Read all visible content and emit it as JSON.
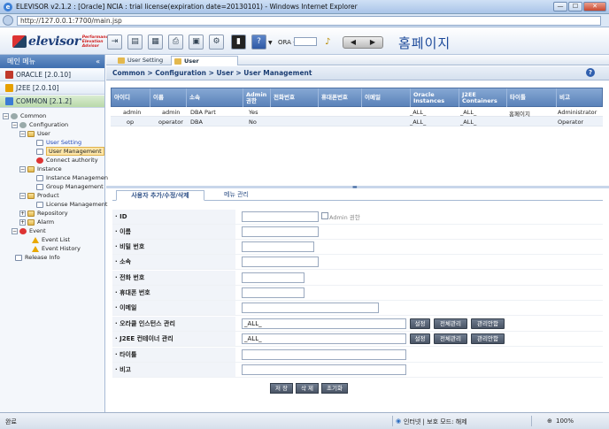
{
  "window": {
    "title": "ELEVISOR v2.1.2 : [Oracle] NCIA : trial license(expiration date=20130101) - Windows Internet Explorer",
    "min": "—",
    "max": "☐",
    "close": "✕",
    "url": "http://127.0.0.1:7700/main.jsp"
  },
  "header": {
    "logo_text": "elevisor",
    "logo_tagline": [
      "Performance",
      "Elevation",
      "Advisor"
    ],
    "ora_label": "ORA -",
    "prev": "◀",
    "next": "▶",
    "home": "홈페이지"
  },
  "sidebar": {
    "title": "메인 메뉴",
    "collapse": "«",
    "groups": [
      {
        "label": "ORACLE [2.0.10]",
        "color": "#c0392b"
      },
      {
        "label": "J2EE [2.0.10]",
        "color": "#e6a000"
      },
      {
        "label": "COMMON [2.1.2]",
        "color": "#3a7bd5"
      }
    ],
    "tree": [
      {
        "label": "Common"
      },
      {
        "label": "Configuration"
      },
      {
        "label": "User"
      },
      {
        "label": "User Setting"
      },
      {
        "label": "User Management"
      },
      {
        "label": "Connect authority"
      },
      {
        "label": "Instance"
      },
      {
        "label": "Instance Managemen"
      },
      {
        "label": "Group Management"
      },
      {
        "label": "Product"
      },
      {
        "label": "License Management"
      },
      {
        "label": "Repository"
      },
      {
        "label": "Alarm"
      },
      {
        "label": "Event"
      },
      {
        "label": "Event List"
      },
      {
        "label": "Event History"
      },
      {
        "label": "Release Info"
      }
    ]
  },
  "tabs": [
    {
      "label": "User Setting"
    },
    {
      "label": "User Management"
    }
  ],
  "breadcrumb": "Common > Configuration > User > User Management",
  "grid": {
    "columns": [
      "아이디",
      "이름",
      "소속",
      "Admin 권한",
      "전화번호",
      "휴대폰번호",
      "이메일",
      "Oracle Instances",
      "J2EE Containers",
      "타이틀",
      "비고"
    ],
    "rows": [
      [
        "admin",
        "admin",
        "DBA Part",
        "Yes",
        "",
        "",
        "",
        "_ALL_",
        "_ALL_",
        "홈페이지",
        "Administrator"
      ],
      [
        "op",
        "operator",
        "DBA",
        "No",
        "",
        "",
        "",
        "_ALL_",
        "_ALL_",
        "",
        "Operator"
      ]
    ]
  },
  "form": {
    "tabs": [
      "사용자 추가/수정/삭제",
      "메뉴 관리"
    ],
    "fields": [
      {
        "label": "· ID",
        "value": ""
      },
      {
        "label": "· 이름",
        "value": ""
      },
      {
        "label": "· 비밀 번호",
        "value": ""
      },
      {
        "label": "· 소속",
        "value": ""
      },
      {
        "label": "· 전화 번호",
        "value": ""
      },
      {
        "label": "· 휴대폰 번호",
        "value": ""
      },
      {
        "label": "· 이메일",
        "value": ""
      },
      {
        "label": "· 오라클 인스턴스 관리",
        "value": "_ALL_"
      },
      {
        "label": "· J2EE 컨테이너 관리",
        "value": "_ALL_"
      },
      {
        "label": "· 타이틀",
        "value": ""
      },
      {
        "label": "· 비고",
        "value": ""
      }
    ],
    "admin_checkbox_label": "Admin 권한",
    "btn_set": "설정",
    "btn_all": "전체관리",
    "btn_clear": "관리안함",
    "actions": [
      "저 장",
      "삭 제",
      "초기화"
    ]
  },
  "status": {
    "left": "완료",
    "zone": "인터넷 | 보호 모드: 해제",
    "zoom": "100%"
  }
}
